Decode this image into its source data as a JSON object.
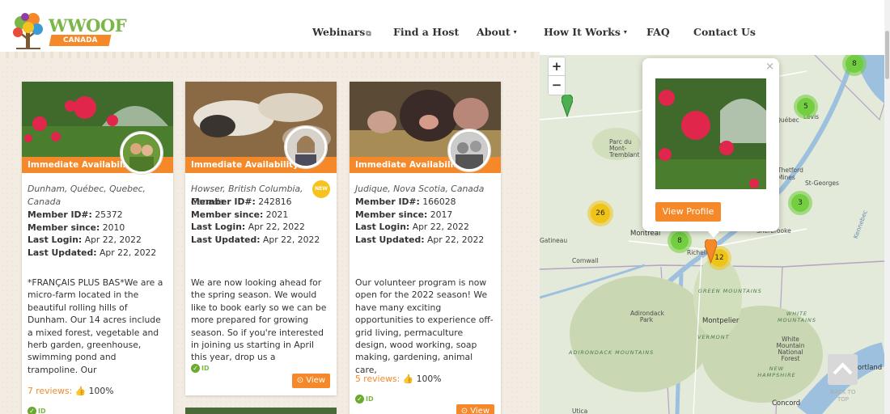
{
  "brand": {
    "name": "WWOOF",
    "sub": "CANADA"
  },
  "nav": [
    {
      "label": "Webinars",
      "ext": "⧉",
      "caret": ""
    },
    {
      "label": "Find a Host",
      "ext": "",
      "caret": ""
    },
    {
      "label": "About",
      "ext": "",
      "caret": "▾"
    },
    {
      "label": "How It Works",
      "ext": "",
      "caret": "▾"
    },
    {
      "label": "FAQ",
      "ext": "",
      "caret": ""
    },
    {
      "label": "Contact Us",
      "ext": "",
      "caret": ""
    }
  ],
  "cards": [
    {
      "availability": "Immediate Availability",
      "location": "Dunham, Québec, Quebec, Canada",
      "member_id_label": "Member ID#:",
      "member_id": "25372",
      "since_label": "Member since:",
      "since": "2010",
      "login_label": "Last Login:",
      "login": "Apr 22, 2022",
      "updated_label": "Last Updated:",
      "updated": "Apr 22, 2022",
      "description": "*FRANÇAIS PLUS BAS*We are a micro-farm located in the beautiful rolling hills of Dunham. Our 14 acres include a mixed forest, vegetable and herb garden, greenhouse, swimming pond and trampoline. Our",
      "reviews": "7 reviews:",
      "percent": "100%",
      "id_label": "ID"
    },
    {
      "availability": "Immediate Availability",
      "location": "Howser, British Columbia, Canada",
      "new_badge": "NEW",
      "member_id_label": "Member ID#:",
      "member_id": "242816",
      "since_label": "Member since:",
      "since": "2021",
      "login_label": "Last Login:",
      "login": "Apr 22, 2022",
      "updated_label": "Last Updated:",
      "updated": "Apr 22, 2022",
      "description": "We are now looking ahead for the spring season. We would like to book early so we can be more prepared for growing season. So if you're interested in joining us starting in April this year, drop us a",
      "id_label": "ID",
      "view_label": "View"
    },
    {
      "availability": "Immediate Availability",
      "location": "Judique, Nova Scotia, Canada",
      "member_id_label": "Member ID#:",
      "member_id": "166028",
      "since_label": "Member since:",
      "since": "2017",
      "login_label": "Last Login:",
      "login": "Apr 22, 2022",
      "updated_label": "Last Updated:",
      "updated": "Apr 22, 2022",
      "description": "Our volunteer program is now open for the 2022 season! We have many exciting opportunities to experience off-grid living, permaculture design, wood working, soap making, gardening, animal care,",
      "reviews": "5 reviews:",
      "percent": "100%",
      "id_label": "ID",
      "view_label": "View"
    }
  ],
  "map": {
    "zoom_in": "+",
    "zoom_out": "−",
    "clusters": [
      "8",
      "5",
      "26",
      "3",
      "8",
      "12"
    ],
    "labels": {
      "montreal": "Montreal",
      "gatineau": "Gatineau",
      "cornwall": "Cornwall",
      "montpelier": "Montpelier",
      "concord": "Concord",
      "portland": "Portland",
      "sherbrooke": "Sherbrooke",
      "thetford": "Thetford Mines",
      "stgeorges": "St-Georges",
      "levis": "Lévis",
      "quebec": "Québec",
      "mont_tremblant": "Parc du Mont-Tremblant",
      "richelieu": "Richelieu",
      "green_mountains": "GREEN MOUNTAINS",
      "white_mountains": "WHITE MOUNTAINS",
      "adirondack_mtns": "ADIRONDACK MOUNTAINS",
      "adirondack_park": "Adirondack Park",
      "vermont": "VERMONT",
      "new_hampshire": "NEW HAMPSHIRE",
      "white_forest": "White Mountain National Forest",
      "utica": "Utica",
      "kennebec": "Kennebec"
    },
    "popup": {
      "close": "×",
      "button": "View Profile"
    },
    "back_to_top": "BACK TO TOP"
  }
}
